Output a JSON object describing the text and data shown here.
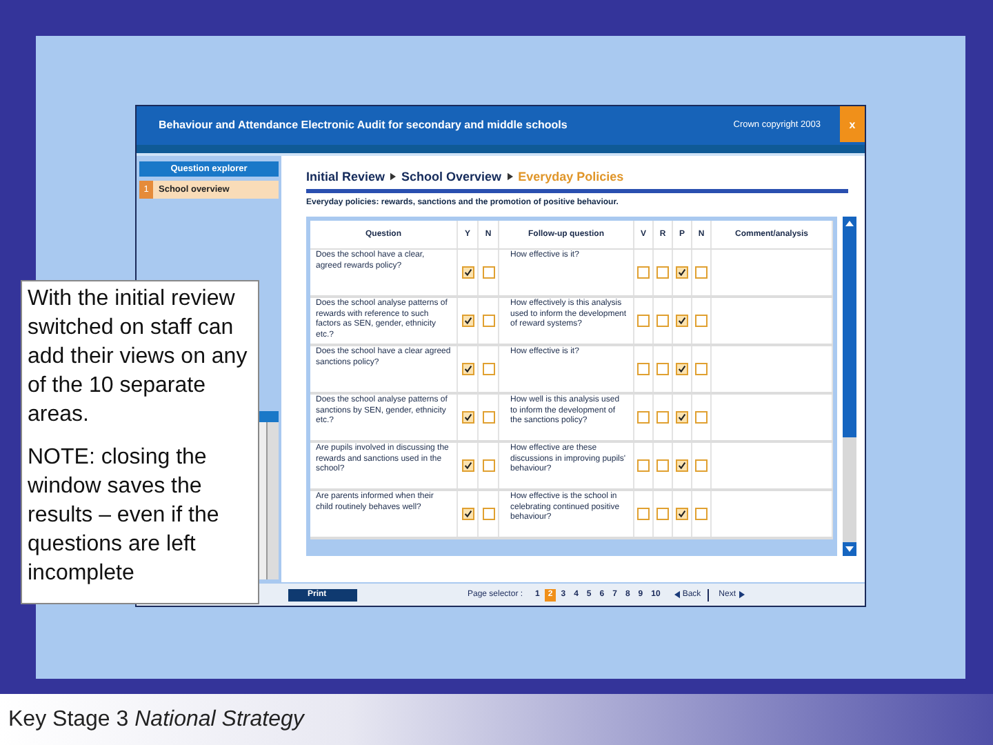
{
  "window": {
    "title": "Behaviour and Attendance Electronic Audit for secondary and middle schools",
    "copyright": "Crown copyright  2003",
    "close": "x"
  },
  "sidebar": {
    "header": "Question explorer",
    "items": [
      {
        "number": "1",
        "label": "School overview",
        "selected": true
      }
    ]
  },
  "breadcrumb": [
    {
      "label": "Initial Review",
      "current": false
    },
    {
      "label": "School Overview",
      "current": false
    },
    {
      "label": "Everyday Policies",
      "current": true
    }
  ],
  "subtitle": "Everyday policies: rewards, sanctions and the promotion of positive behaviour.",
  "table": {
    "columns": [
      "Question",
      "Y",
      "N",
      "Follow-up question",
      "V",
      "R",
      "P",
      "N",
      "Comment/analysis"
    ],
    "rows": [
      {
        "question": "Does the school have a clear, agreed rewards policy?",
        "yn": [
          true,
          false
        ],
        "followup": "How effective is it?",
        "vrpn": [
          false,
          false,
          true,
          false
        ]
      },
      {
        "question": "Does the school analyse patterns of rewards with reference to such factors as SEN, gender, ethnicity etc.?",
        "yn": [
          true,
          false
        ],
        "followup": "How effectively is this analysis used to inform the development of reward systems?",
        "vrpn": [
          false,
          false,
          true,
          false
        ]
      },
      {
        "question": "Does the school have a clear agreed sanctions policy?",
        "yn": [
          true,
          false
        ],
        "followup": "How effective is it?",
        "vrpn": [
          false,
          false,
          true,
          false
        ]
      },
      {
        "question": "Does the school analyse patterns of sanctions by SEN, gender, ethnicity etc.?",
        "yn": [
          true,
          false
        ],
        "followup": "How well is this analysis used to inform the development of the sanctions policy?",
        "vrpn": [
          false,
          false,
          true,
          false
        ]
      },
      {
        "question": "Are pupils involved in discussing the rewards and sanctions used in the school?",
        "yn": [
          true,
          false
        ],
        "followup": "How effective are these discussions in improving pupils' behaviour?",
        "vrpn": [
          false,
          false,
          true,
          false
        ]
      },
      {
        "question": "Are parents informed when their child routinely behaves well?",
        "yn": [
          true,
          false
        ],
        "followup": "How effective is the school in celebrating continued positive behaviour?",
        "vrpn": [
          false,
          false,
          true,
          false
        ]
      }
    ]
  },
  "footer_bar": {
    "print": "Print",
    "page_selector_label": "Page selector :",
    "pages": [
      {
        "label": "1",
        "selected": false
      },
      {
        "label": "2",
        "selected": true
      },
      {
        "label": "3",
        "selected": false
      },
      {
        "label": "4",
        "selected": false
      },
      {
        "label": "5",
        "selected": false
      },
      {
        "label": "6",
        "selected": false
      },
      {
        "label": "7",
        "selected": false
      },
      {
        "label": "8",
        "selected": false
      },
      {
        "label": "9",
        "selected": false
      },
      {
        "label": "10",
        "selected": false
      }
    ],
    "back": "Back",
    "next": "Next"
  },
  "callout": {
    "paragraphs": [
      "With the initial review switched on staff can add their views on any of the 10 separate areas.",
      "NOTE: closing the window saves the results – even if the questions are left incomplete"
    ]
  },
  "slide_footer": "Key Stage 3 *National Strategy*"
}
